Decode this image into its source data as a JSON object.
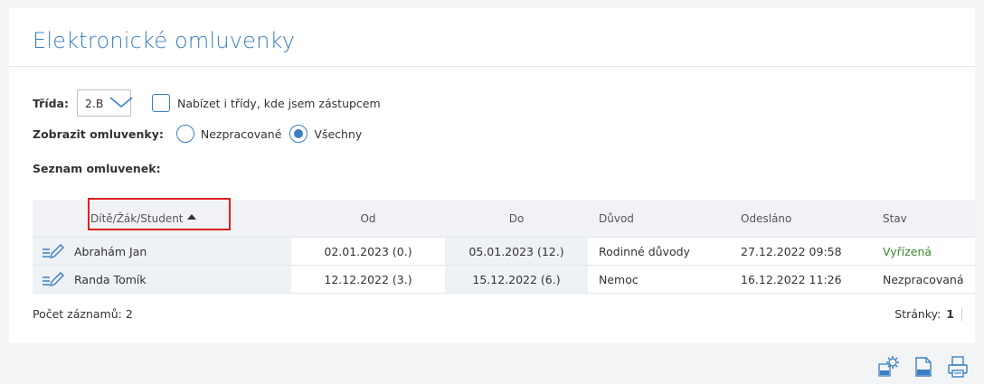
{
  "header": {
    "title": "Elektronické omluvenky"
  },
  "filters": {
    "trida_label": "Třída:",
    "trida_value": "2.B",
    "substitute_checkbox_label": "Nabízet i třídy, kde jsem zástupcem",
    "substitute_checked": false,
    "zobrazit_label": "Zobrazit omluvenky:",
    "options": [
      "Nezpracované",
      "Všechny"
    ],
    "selected": "Všechny"
  },
  "list": {
    "title": "Seznam omluvenek:",
    "columns": [
      "Dítě/Žák/Student",
      "Od",
      "Do",
      "Důvod",
      "Odesláno",
      "Stav"
    ],
    "sort_column": "Dítě/Žák/Student",
    "sort_direction": "ascending",
    "rows": [
      {
        "name": "Abrahám Jan",
        "od": "02.01.2023 (0.)",
        "do": "05.01.2023 (12.)",
        "duvod": "Rodinné důvody",
        "odeslano": "27.12.2022 09:58",
        "stav": "Vyřízená"
      },
      {
        "name": "Randa Tomík",
        "od": "12.12.2022 (3.)",
        "do": "15.12.2022 (6.)",
        "duvod": "Nemoc",
        "odeslano": "16.12.2022 11:26",
        "stav": "Nezpracovaná"
      }
    ],
    "count_label": "Počet záznamů: 2",
    "pages_label": "Stránky:",
    "current_page": "1"
  },
  "colors": {
    "accent": "#3a7fc3",
    "status_done": "#3c8a2e",
    "highlight": "#e02020"
  },
  "icons": [
    "edit-icon",
    "export-xls-settings-icon",
    "export-xls-icon",
    "print-icon"
  ]
}
